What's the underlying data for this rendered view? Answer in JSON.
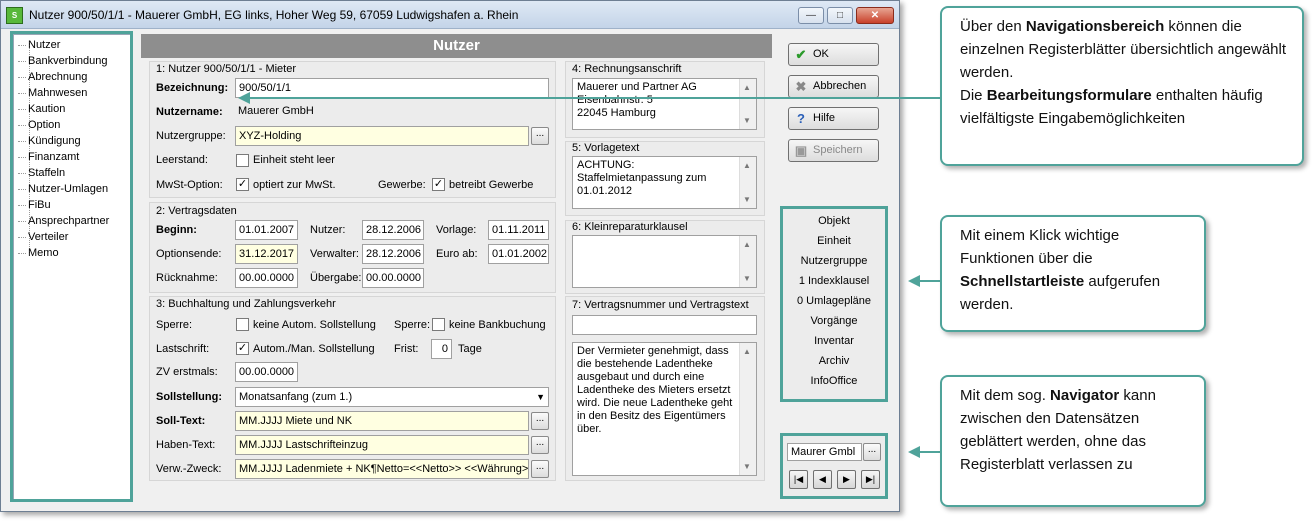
{
  "window": {
    "title": "Nutzer 900/50/1/1 - Mauerer GmbH, EG links, Hoher Weg 59, 67059 Ludwigshafen a. Rhein",
    "minimize": "—",
    "maximize": "□",
    "close": "✕"
  },
  "nav": {
    "items": [
      "Nutzer",
      "Bankverbindung",
      "Abrechnung",
      "Mahnwesen",
      "Kaution",
      "Option",
      "Kündigung",
      "Finanzamt",
      "Staffeln",
      "Nutzer-Umlagen",
      "FiBu",
      "Ansprechpartner",
      "Verteiler",
      "Memo"
    ]
  },
  "header": {
    "title": "Nutzer"
  },
  "g1": {
    "title": "1: Nutzer 900/50/1/1 - Mieter",
    "bez_label": "Bezeichnung:",
    "bez_value": "900/50/1/1",
    "name_label": "Nutzername:",
    "name_value": "Mauerer GmbH",
    "gruppe_label": "Nutzergruppe:",
    "gruppe_value": "XYZ-Holding",
    "leer_label": "Leerstand:",
    "leer_cb": "Einheit steht leer",
    "mwst_label": "MwSt-Option:",
    "mwst_cb": "optiert zur MwSt.",
    "gew_label": "Gewerbe:",
    "gew_cb": "betreibt Gewerbe"
  },
  "g2": {
    "title": "2: Vertragsdaten",
    "beginn_label": "Beginn:",
    "beginn_value": "01.01.2007",
    "ende_label": "Optionsende:",
    "ende_value": "31.12.2017",
    "rueck_label": "Rücknahme:",
    "rueck_value": "00.00.0000",
    "nutzer_label": "Nutzer:",
    "nutzer_value": "28.12.2006",
    "verw_label": "Verwalter:",
    "verw_value": "28.12.2006",
    "ueb_label": "Übergabe:",
    "ueb_value": "00.00.0000",
    "vorl_label": "Vorlage:",
    "vorl_value": "01.11.2011",
    "euro_label": "Euro ab:",
    "euro_value": "01.01.2002"
  },
  "g3": {
    "title": "3: Buchhaltung und Zahlungsverkehr",
    "sperre_label": "Sperre:",
    "sperre_cb": "keine Autom. Sollstellung",
    "sperre2_label": "Sperre:",
    "sperre2_cb": "keine Bankbuchung",
    "last_label": "Lastschrift:",
    "last_cb": "Autom./Man. Sollstellung",
    "frist_label": "Frist:",
    "frist_value": "0",
    "tage_label": "Tage",
    "zv_label": "ZV erstmals:",
    "zv_value": "00.00.0000",
    "soll_label": "Sollstellung:",
    "soll_value": "Monatsanfang (zum 1.)",
    "solltext_label": "Soll-Text:",
    "solltext_value": "MM.JJJJ Miete und NK",
    "haben_label": "Haben-Text:",
    "haben_value": "MM.JJJJ Lastschrifteinzug",
    "zweck_label": "Verw.-Zweck:",
    "zweck_value": "MM.JJJJ Ladenmiete + NK¶Netto=<<Netto>> <<Währung>>'"
  },
  "g4": {
    "title": "4: Rechnungsanschrift",
    "text": "Mauerer und Partner AG\nEisenbahnstr. 5\n22045 Hamburg"
  },
  "g5": {
    "title": "5: Vorlagetext",
    "text": "ACHTUNG:\nStaffelmietanpassung zum\n01.01.2012"
  },
  "g6": {
    "title": "6: Kleinreparaturklausel",
    "text": ""
  },
  "g7": {
    "title": "7: Vertragsnummer und Vertragstext",
    "nummer": "",
    "text": "Der Vermieter genehmigt, dass\ndie bestehende Ladentheke\nausgebaut und durch eine\nLadentheke des Mieters ersetzt\nwird. Die neue Ladentheke geht\nin den Besitz des Eigentümers\nüber."
  },
  "buttons": {
    "ok": "OK",
    "abbrechen": "Abbrechen",
    "hilfe": "Hilfe",
    "speichern": "Speichern"
  },
  "quick": {
    "items": [
      "Objekt",
      "Einheit",
      "Nutzergruppe",
      "1 Indexklausel",
      "0 Umlagepläne",
      "Vorgänge",
      "Inventar",
      "Archiv",
      "InfoOffice"
    ]
  },
  "navigator": {
    "value": "Maurer Gmbl",
    "first": "|◀",
    "prev": "◀",
    "next": "▶",
    "last": "▶|"
  },
  "callouts": {
    "c1": {
      "p1": "Über den ",
      "b1": "Navigationsbereich",
      "p2": " können die einzelnen Registerblätter übersichtlich angewählt werden.",
      "p3": "Die ",
      "b2": "Bearbeitungsformulare",
      "p4": " enthalten häufig vielfältigste Eingabemöglichkeiten"
    },
    "c2": {
      "p1": "Mit einem Klick wichtige Funktionen über die ",
      "b1": "Schnellstartleiste",
      "p2": " aufgerufen werden."
    },
    "c3": {
      "p1": "Mit dem sog. ",
      "b1": "Navigator",
      "p2": " kann zwischen den Datensätzen geblättert werden, ohne das Registerblatt verlassen zu"
    }
  },
  "colors": {
    "accent": "#4fa39a",
    "header": "#8e8e8e",
    "yellow_field": "#ffffe1"
  }
}
